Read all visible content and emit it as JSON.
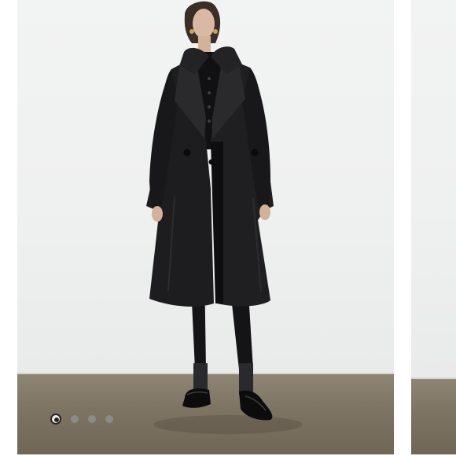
{
  "gallery": {
    "image_alt": "",
    "slide_count": 4,
    "active_index": 0
  },
  "colors": {
    "wall": "#eff0f0",
    "floor": "#7f7565",
    "coat": "#1d1d1f",
    "dot_inactive": "#8e8e8e",
    "dot_active": "#1e1e1e"
  }
}
